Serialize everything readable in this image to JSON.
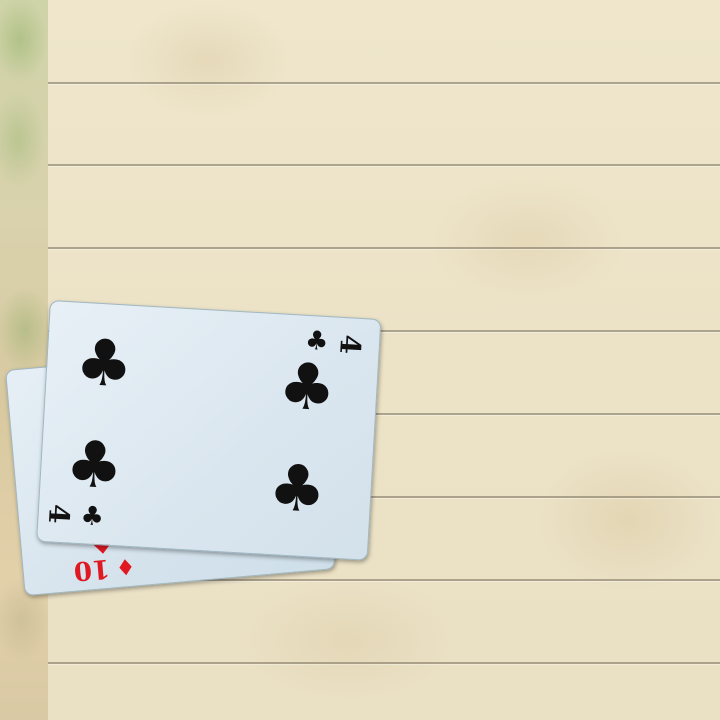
{
  "table": {
    "surface": "parchment",
    "line_color": "#7a7060"
  },
  "cards": {
    "back": {
      "rank": "10",
      "suit": "diamonds",
      "suit_symbol": "♦",
      "color": "#e01822"
    },
    "front": {
      "rank": "4",
      "suit": "clubs",
      "suit_symbol": "♣",
      "color": "#111111"
    }
  }
}
